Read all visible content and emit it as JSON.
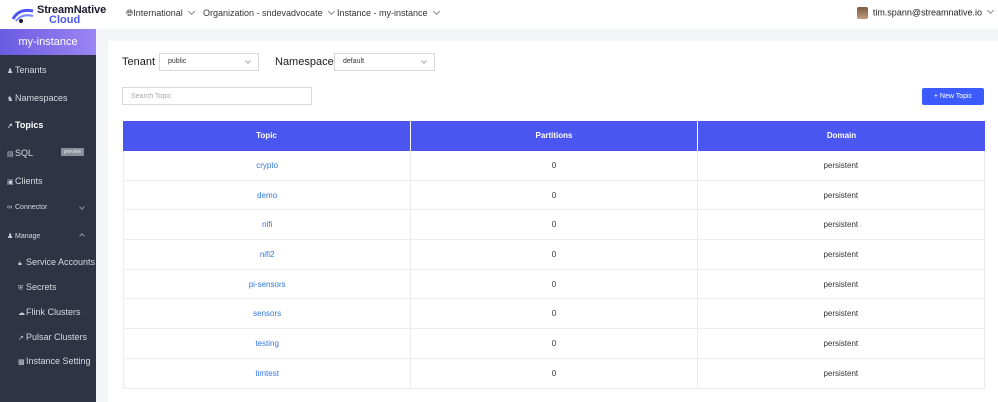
{
  "topbar": {
    "logo_line1": "StreamNative",
    "logo_line2": "Cloud",
    "international": "International",
    "organization": "Organization - sndevadvocate",
    "instance": "Instance - my-instance",
    "user_email": "tim.spann@streamnative.io"
  },
  "sidebar": {
    "instance_title": "my-instance",
    "items": {
      "tenants": "Tenants",
      "namespaces": "Namespaces",
      "topics": "Topics",
      "sql": "SQL",
      "sql_badge": "preview",
      "clients": "Clients",
      "connector": "Connector",
      "manage": "Manage"
    },
    "manage_items": {
      "service_accounts": "Service Accounts",
      "secrets": "Secrets",
      "flink_clusters": "Flink Clusters",
      "pulsar_clusters": "Pulsar Clusters",
      "instance_setting": "Instance Setting"
    }
  },
  "filters": {
    "tenant_label": "Tenant",
    "tenant_value": "public",
    "namespace_label": "Namespace",
    "namespace_value": "default"
  },
  "search": {
    "placeholder": "Search Topic"
  },
  "new_topic_label": "+ New Topic",
  "table": {
    "headers": {
      "topic": "Topic",
      "partitions": "Partitions",
      "domain": "Domain"
    },
    "rows": [
      {
        "topic": "crypto",
        "partitions": "0",
        "domain": "persistent"
      },
      {
        "topic": "demo",
        "partitions": "0",
        "domain": "persistent"
      },
      {
        "topic": "nifi",
        "partitions": "0",
        "domain": "persistent"
      },
      {
        "topic": "nifi2",
        "partitions": "0",
        "domain": "persistent"
      },
      {
        "topic": "pi-sensors",
        "partitions": "0",
        "domain": "persistent"
      },
      {
        "topic": "sensors",
        "partitions": "0",
        "domain": "persistent"
      },
      {
        "topic": "testing",
        "partitions": "0",
        "domain": "persistent"
      },
      {
        "topic": "timtest",
        "partitions": "0",
        "domain": "persistent"
      }
    ]
  },
  "colors": {
    "accent": "#4b56f0",
    "button": "#3b5bff",
    "sidebar": "#2f3444",
    "link": "#3077e0"
  }
}
